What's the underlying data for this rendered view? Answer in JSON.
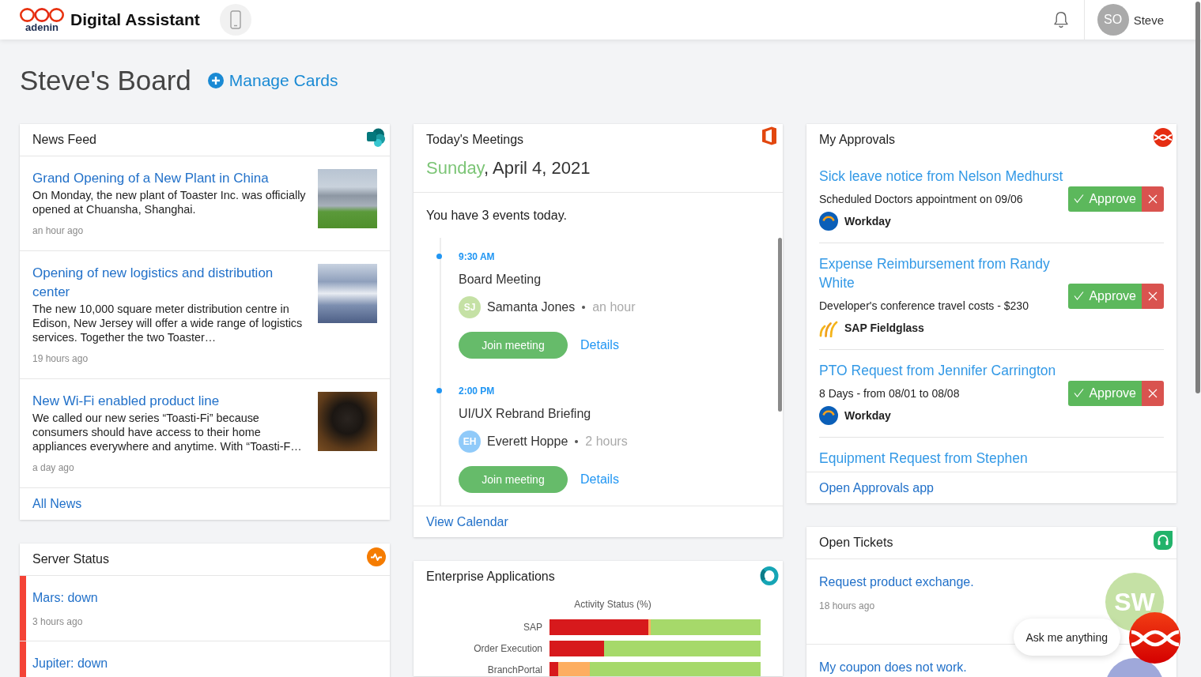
{
  "header": {
    "brand": "adenin",
    "title": "Digital Assistant",
    "user": {
      "initials": "SO",
      "name": "Steve"
    }
  },
  "board": {
    "title": "Steve's Board",
    "manage_link": "Manage Cards"
  },
  "news_feed": {
    "title": "News Feed",
    "items": [
      {
        "title": "Grand Opening of a New Plant in China",
        "summary": "On Monday, the new plant of Toaster Inc. was officially opened at Chuansha, Shanghai.",
        "time": "an hour ago"
      },
      {
        "title": "Opening of new logistics and distribution center",
        "summary": "The new 10,000 square meter distribution centre in Edison, New Jersey will offer a wide range of logistics services. Together the two Toaster…",
        "time": "19 hours ago"
      },
      {
        "title": "New Wi-Fi enabled product line",
        "summary": "We called our new series “Toasti-Fi” because consumers should have access to their home appliances everywhere and anytime. With “Toasti-F…",
        "time": "a day ago"
      }
    ],
    "footer_link": "All News"
  },
  "server_status": {
    "title": "Server Status",
    "items": [
      {
        "name": "Mars: down",
        "time": "3 hours ago",
        "color": "#f44336"
      },
      {
        "name": "Jupiter: down",
        "color": "#f44336"
      }
    ]
  },
  "meetings": {
    "title": "Today's Meetings",
    "day": "Sunday",
    "date": ", April 4, 2021",
    "summary": "You have 3 events today.",
    "events": [
      {
        "time": "9:30 AM",
        "title": "Board Meeting",
        "initials": "SJ",
        "organizer": "Samanta Jones",
        "color": "#c5e1a5",
        "duration": "an hour",
        "join_label": "Join meeting",
        "details_label": "Details"
      },
      {
        "time": "2:00 PM",
        "title": "UI/UX Rebrand Briefing",
        "initials": "EH",
        "organizer": "Everett Hoppe",
        "color": "#90caf9",
        "duration": "2 hours",
        "join_label": "Join meeting",
        "details_label": "Details"
      }
    ],
    "footer_link": "View Calendar"
  },
  "enterprise_apps": {
    "title": "Enterprise Applications",
    "chart": {
      "title": "Activity Status (%)",
      "categories": [
        "SAP",
        "Order Execution",
        "BranchPortal"
      ]
    }
  },
  "approvals": {
    "title": "My Approvals",
    "items": [
      {
        "title": "Sick leave notice from Nelson Medhurst",
        "description": "Scheduled Doctors appointment on 09/06",
        "source": {
          "kind": "workday",
          "name": "Workday"
        },
        "approve_label": "Approve"
      },
      {
        "title": "Expense Reimbursement from Randy White",
        "description": "Developer's conference travel costs - $230",
        "source": {
          "kind": "fieldglass",
          "name": "SAP Fieldglass"
        },
        "approve_label": "Approve"
      },
      {
        "title": "PTO Request from Jennifer Carrington",
        "description": "8 Days - from 08/01 to 08/08",
        "source": {
          "kind": "workday",
          "name": "Workday"
        },
        "approve_label": "Approve"
      },
      {
        "title": "Equipment Request from Stephen"
      }
    ],
    "footer_link": "Open Approvals app"
  },
  "tickets": {
    "title": "Open Tickets",
    "items": [
      {
        "title": "Request product exchange.",
        "time": "18 hours ago",
        "assignee": {
          "initials": "SW",
          "color": "#c5e1a5"
        }
      },
      {
        "title": "My coupon does not work.",
        "assignee": {
          "color": "#9fa8da"
        }
      }
    ]
  },
  "assistant": {
    "prompt": "Ask me anything"
  }
}
